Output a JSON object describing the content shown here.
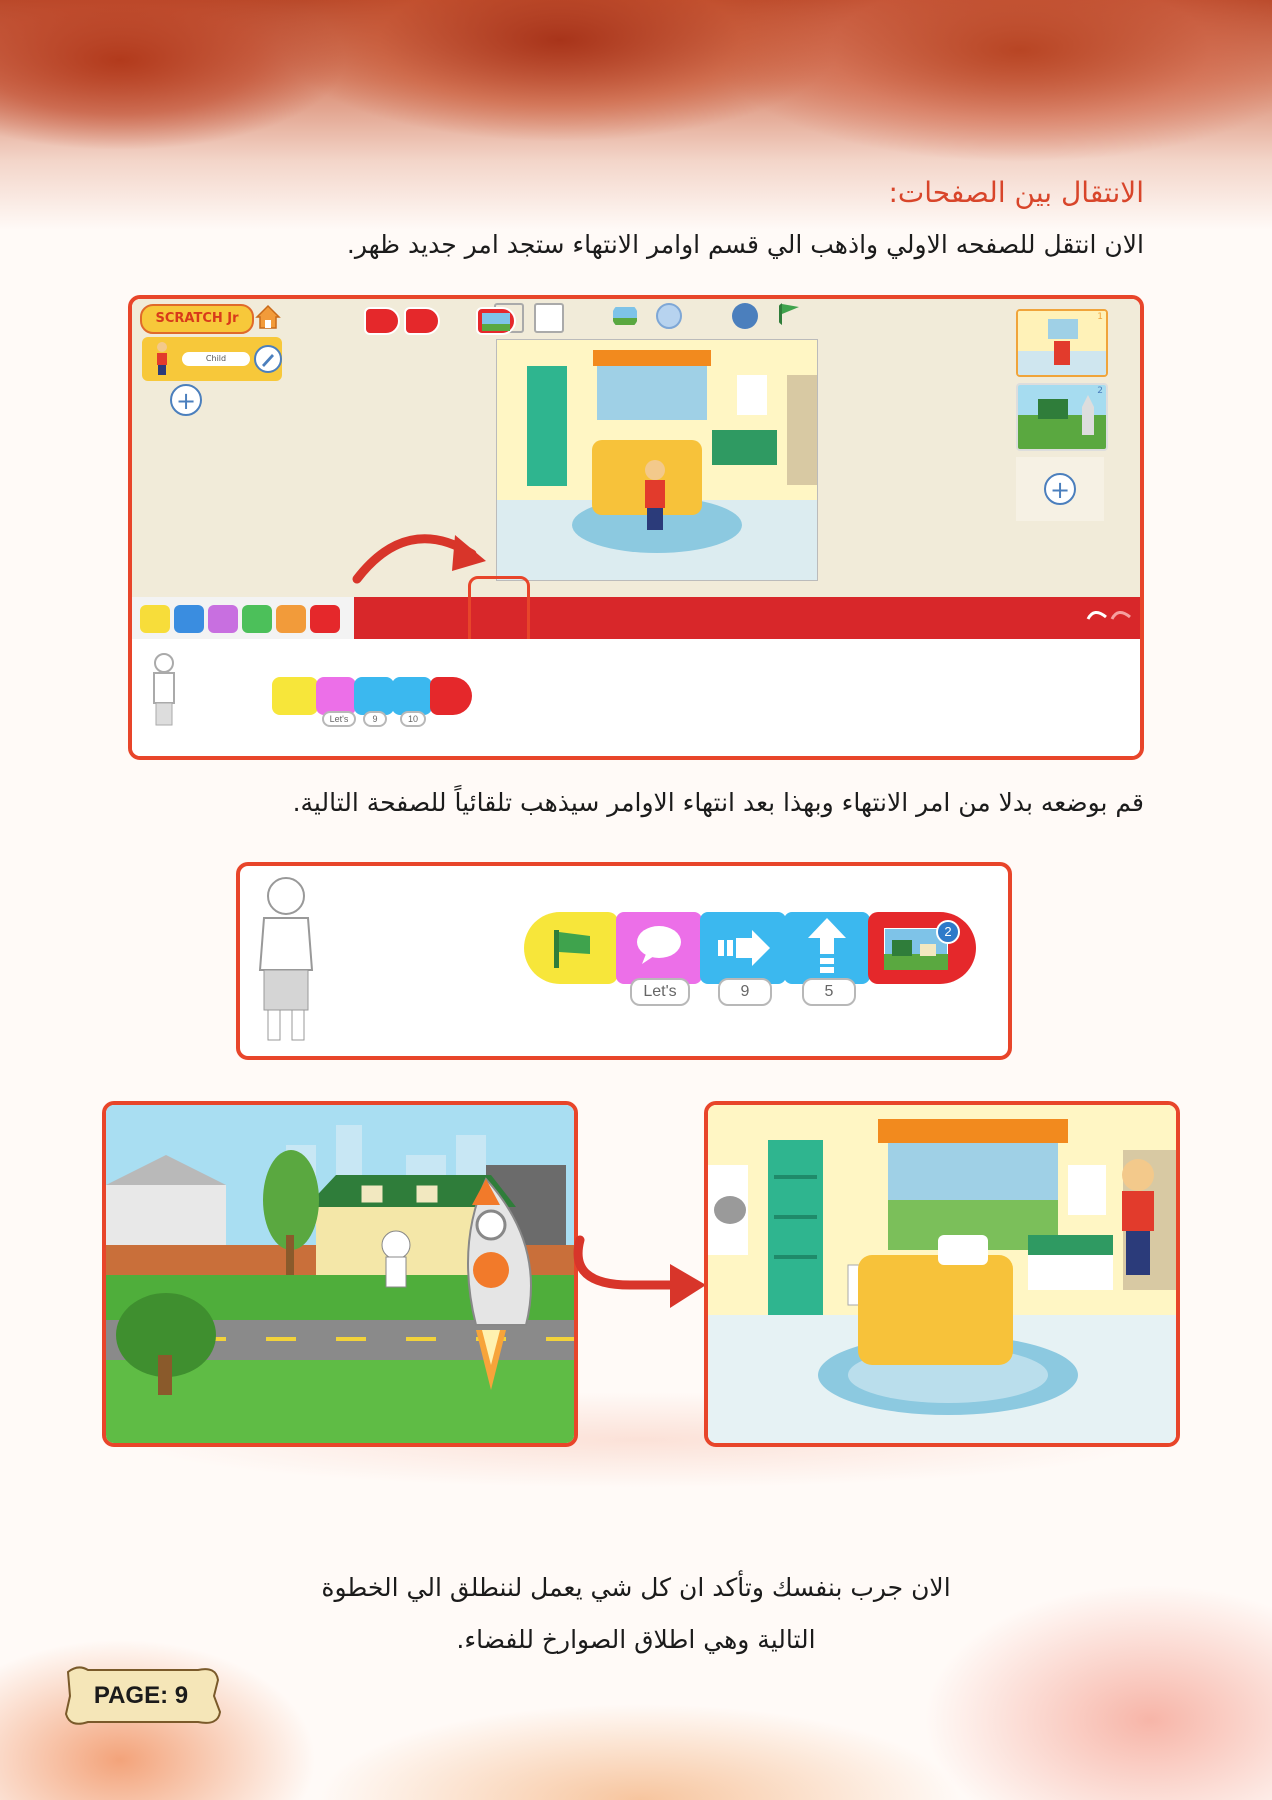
{
  "section_title": "الانتقال بين الصفحات:",
  "intro": "الان انتقل للصفحه الاولي واذهب الي قسم اوامر الانتهاء ستجد امر جديد ظهر.",
  "instruction": "قم بوضعه بدلا من امر الانتهاء وبهذا بعد انتهاء الاوامر سيذهب تلقائياً للصفحة التالية.",
  "closing_line1": "الان جرب بنفسك وتأكد ان كل شي يعمل لننطلق الي الخطوة",
  "closing_line2": "التالية وهي اطلاق الصوارخ للفضاء.",
  "page_label": "PAGE: 9",
  "scratch_ui": {
    "logo": "SCRATCH Jr",
    "character_name": "Child",
    "page_numbers": [
      "1",
      "2"
    ],
    "script_labels": [
      "Let's",
      "9",
      "10"
    ]
  },
  "zoom_script": {
    "labels": [
      "Let's",
      "9",
      "5"
    ],
    "page_badge": "2"
  },
  "colors": {
    "accent": "#e8452a",
    "title": "#d8452a",
    "bar_red": "#d8272a"
  }
}
